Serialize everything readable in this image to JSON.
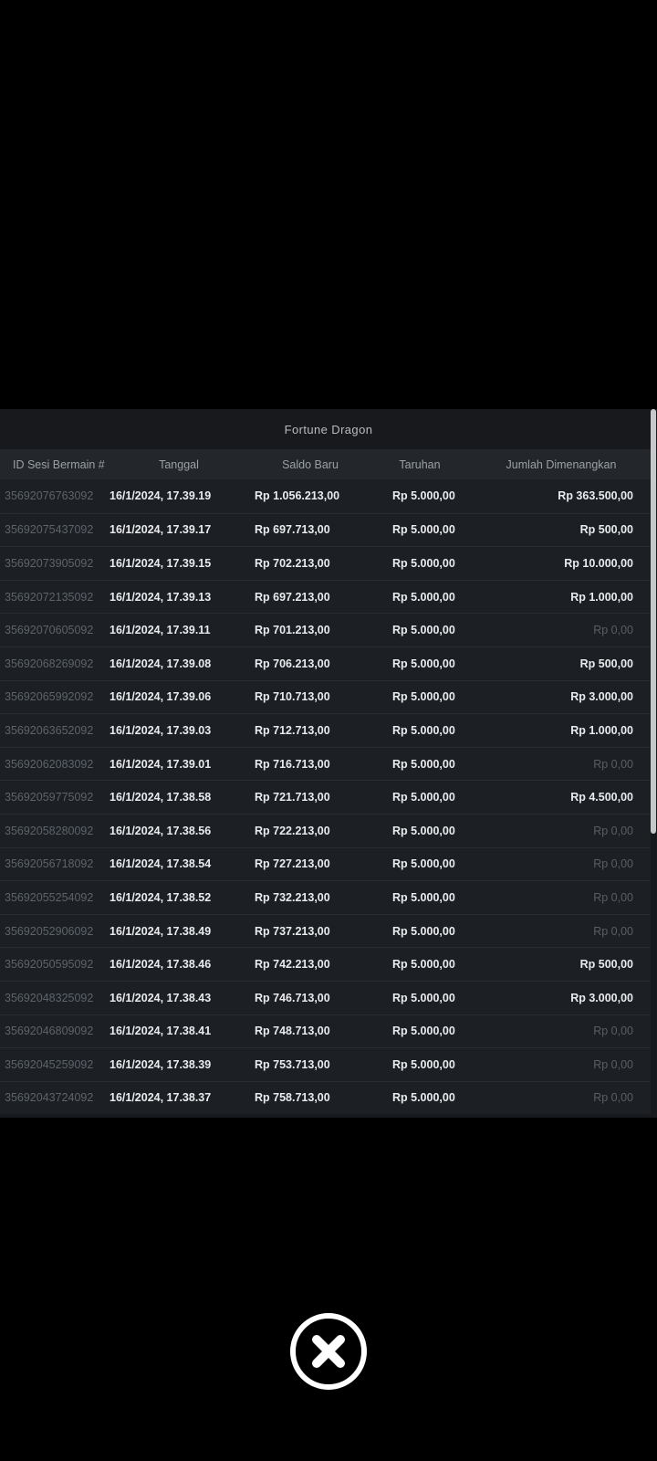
{
  "modal": {
    "title": "Fortune Dragon",
    "columns": [
      "ID Sesi Bermain #",
      "Tanggal",
      "Saldo Baru",
      "Taruhan",
      "Jumlah Dimenangkan"
    ],
    "rows": [
      {
        "id": "35692076763092",
        "date": "16/1/2024, 17.39.19",
        "balance": "Rp 1.056.213,00",
        "bet": "Rp 5.000,00",
        "win": "Rp 363.500,00"
      },
      {
        "id": "35692075437092",
        "date": "16/1/2024, 17.39.17",
        "balance": "Rp 697.713,00",
        "bet": "Rp 5.000,00",
        "win": "Rp 500,00"
      },
      {
        "id": "35692073905092",
        "date": "16/1/2024, 17.39.15",
        "balance": "Rp 702.213,00",
        "bet": "Rp 5.000,00",
        "win": "Rp 10.000,00"
      },
      {
        "id": "35692072135092",
        "date": "16/1/2024, 17.39.13",
        "balance": "Rp 697.213,00",
        "bet": "Rp 5.000,00",
        "win": "Rp 1.000,00"
      },
      {
        "id": "35692070605092",
        "date": "16/1/2024, 17.39.11",
        "balance": "Rp 701.213,00",
        "bet": "Rp 5.000,00",
        "win": "Rp 0,00"
      },
      {
        "id": "35692068269092",
        "date": "16/1/2024, 17.39.08",
        "balance": "Rp 706.213,00",
        "bet": "Rp 5.000,00",
        "win": "Rp 500,00"
      },
      {
        "id": "35692065992092",
        "date": "16/1/2024, 17.39.06",
        "balance": "Rp 710.713,00",
        "bet": "Rp 5.000,00",
        "win": "Rp 3.000,00"
      },
      {
        "id": "35692063652092",
        "date": "16/1/2024, 17.39.03",
        "balance": "Rp 712.713,00",
        "bet": "Rp 5.000,00",
        "win": "Rp 1.000,00"
      },
      {
        "id": "35692062083092",
        "date": "16/1/2024, 17.39.01",
        "balance": "Rp 716.713,00",
        "bet": "Rp 5.000,00",
        "win": "Rp 0,00"
      },
      {
        "id": "35692059775092",
        "date": "16/1/2024, 17.38.58",
        "balance": "Rp 721.713,00",
        "bet": "Rp 5.000,00",
        "win": "Rp 4.500,00"
      },
      {
        "id": "35692058280092",
        "date": "16/1/2024, 17.38.56",
        "balance": "Rp 722.213,00",
        "bet": "Rp 5.000,00",
        "win": "Rp 0,00"
      },
      {
        "id": "35692056718092",
        "date": "16/1/2024, 17.38.54",
        "balance": "Rp 727.213,00",
        "bet": "Rp 5.000,00",
        "win": "Rp 0,00"
      },
      {
        "id": "35692055254092",
        "date": "16/1/2024, 17.38.52",
        "balance": "Rp 732.213,00",
        "bet": "Rp 5.000,00",
        "win": "Rp 0,00"
      },
      {
        "id": "35692052906092",
        "date": "16/1/2024, 17.38.49",
        "balance": "Rp 737.213,00",
        "bet": "Rp 5.000,00",
        "win": "Rp 0,00"
      },
      {
        "id": "35692050595092",
        "date": "16/1/2024, 17.38.46",
        "balance": "Rp 742.213,00",
        "bet": "Rp 5.000,00",
        "win": "Rp 500,00"
      },
      {
        "id": "35692048325092",
        "date": "16/1/2024, 17.38.43",
        "balance": "Rp 746.713,00",
        "bet": "Rp 5.000,00",
        "win": "Rp 3.000,00"
      },
      {
        "id": "35692046809092",
        "date": "16/1/2024, 17.38.41",
        "balance": "Rp 748.713,00",
        "bet": "Rp 5.000,00",
        "win": "Rp 0,00"
      },
      {
        "id": "35692045259092",
        "date": "16/1/2024, 17.38.39",
        "balance": "Rp 753.713,00",
        "bet": "Rp 5.000,00",
        "win": "Rp 0,00"
      },
      {
        "id": "35692043724092",
        "date": "16/1/2024, 17.38.37",
        "balance": "Rp 758.713,00",
        "bet": "Rp 5.000,00",
        "win": "Rp 0,00"
      }
    ],
    "zero_win_value": "Rp 0,00"
  },
  "close_button": {
    "icon": "x-circle-icon"
  },
  "colors": {
    "background": "#000000",
    "panel": "#17191c",
    "header_band": "#23272b",
    "row": "#1c1f23",
    "text_bright": "#e9ebee",
    "text_dim": "#5d646b",
    "scrollbar": "#c6c8ca",
    "close_icon": "#ffffff"
  }
}
